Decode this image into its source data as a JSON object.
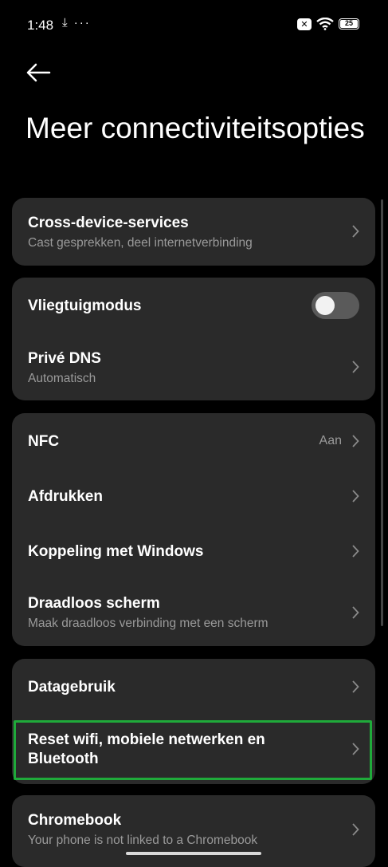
{
  "status_bar": {
    "time": "1:48",
    "left_icons": "⤓ ···",
    "battery_level": "25"
  },
  "header": {
    "title": "Meer connectiviteitsopties"
  },
  "cards": {
    "cross_device": {
      "title": "Cross-device-services",
      "subtitle": "Cast gesprekken, deel internetverbinding"
    },
    "network": {
      "airplane": {
        "title": "Vliegtuigmodus",
        "toggle_on": false
      },
      "private_dns": {
        "title": "Privé DNS",
        "subtitle": "Automatisch"
      }
    },
    "connections": {
      "nfc": {
        "title": "NFC",
        "value": "Aan"
      },
      "print": {
        "title": "Afdrukken"
      },
      "windows": {
        "title": "Koppeling met Windows"
      },
      "cast": {
        "title": "Draadloos scherm",
        "subtitle": "Maak draadloos verbinding met een scherm"
      }
    },
    "data": {
      "usage": {
        "title": "Datagebruik"
      },
      "reset_line1": "Reset wifi, mobiele netwerken en",
      "reset_line2": "Bluetooth"
    },
    "chromebook": {
      "title": "Chromebook",
      "subtitle": "Your phone is not linked to a Chromebook"
    }
  },
  "colors": {
    "background": "#000000",
    "card": "#2a2a2a",
    "highlight": "#1faa3a",
    "secondary_text": "#9a9a9a"
  }
}
